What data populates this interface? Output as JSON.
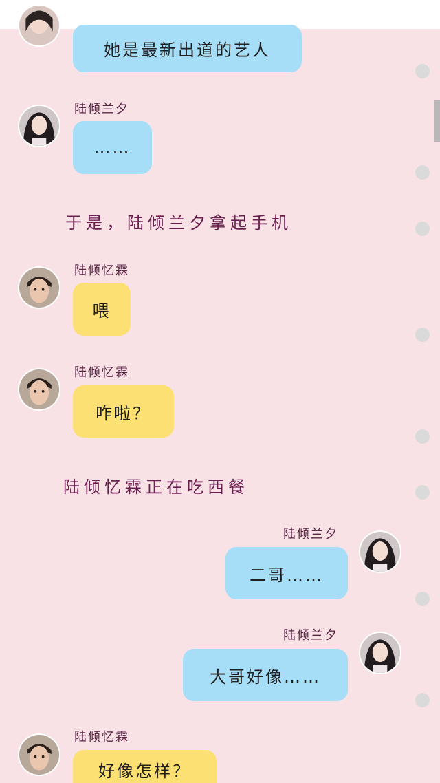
{
  "names": {
    "female": "陆倾兰夕",
    "male": "陆倾忆霖"
  },
  "messages": {
    "m1": "她是最新出道的艺人",
    "m2": "……",
    "m3": "喂",
    "m4": "咋啦？",
    "m5": "二哥……",
    "m6": "大哥好像……",
    "m7": "好像怎样？"
  },
  "narration": {
    "n1": "于是，陆倾兰夕拿起手机",
    "n2": "陆倾忆霖正在吃西餐"
  },
  "colors": {
    "background": "#f8e2e6",
    "bubble_blue": "#a6def8",
    "bubble_yellow": "#fde073",
    "narration_text": "#6b1e4f"
  },
  "icons": {
    "side_dot": "circle-dot-icon"
  }
}
